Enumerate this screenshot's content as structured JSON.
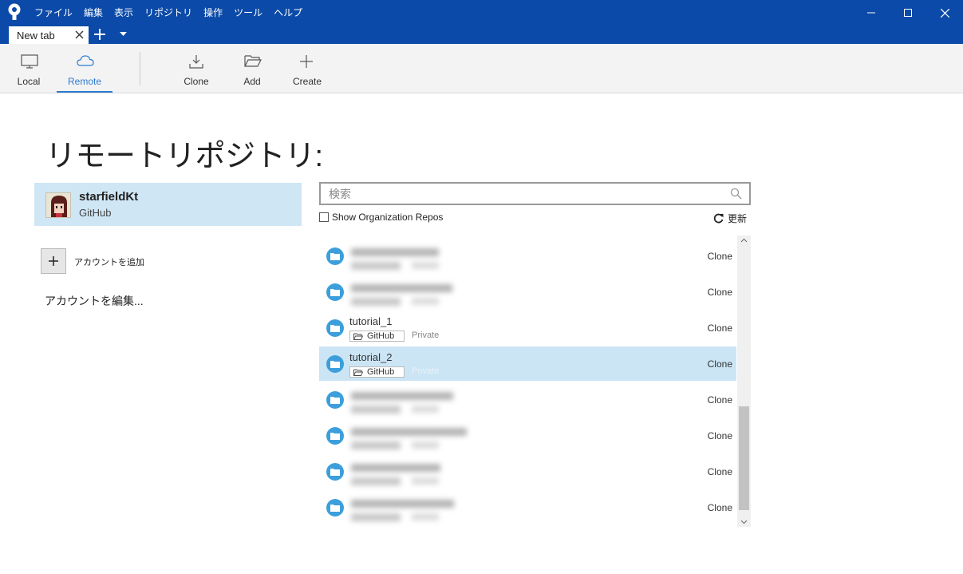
{
  "menu": [
    "ファイル",
    "編集",
    "表示",
    "リポジトリ",
    "操作",
    "ツール",
    "ヘルプ"
  ],
  "tab": {
    "label": "New tab"
  },
  "toolbar": {
    "local": "Local",
    "remote": "Remote",
    "clone": "Clone",
    "add": "Add",
    "create": "Create"
  },
  "heading": "リモートリポジトリ:",
  "account": {
    "name": "starfieldKt",
    "host": "GitHub"
  },
  "add_account_label": "アカウントを追加",
  "edit_accounts_label": "アカウントを編集...",
  "search": {
    "placeholder": "検索"
  },
  "org_repos_label": "Show Organization Repos",
  "refresh_label": "更新",
  "repos": [
    {
      "name": "",
      "host": "",
      "visibility": "",
      "clone": "Clone",
      "blurred": true
    },
    {
      "name": "",
      "host": "",
      "visibility": "",
      "clone": "Clone",
      "blurred": true
    },
    {
      "name": "tutorial_1",
      "host": "GitHub",
      "visibility": "Private",
      "clone": "Clone",
      "blurred": false
    },
    {
      "name": "tutorial_2",
      "host": "GitHub",
      "visibility": "Private",
      "clone": "Clone",
      "blurred": false,
      "selected": true
    },
    {
      "name": "",
      "host": "",
      "visibility": "",
      "clone": "Clone",
      "blurred": true
    },
    {
      "name": "",
      "host": "",
      "visibility": "",
      "clone": "Clone",
      "blurred": true
    },
    {
      "name": "",
      "host": "",
      "visibility": "",
      "clone": "Clone",
      "blurred": true
    },
    {
      "name": "",
      "host": "",
      "visibility": "",
      "clone": "Clone",
      "blurred": true
    }
  ],
  "colors": {
    "titlebar": "#0b4aa8",
    "accent": "#2e7bd0",
    "selection": "#cbe5f5",
    "folder": "#3c9fdc"
  }
}
